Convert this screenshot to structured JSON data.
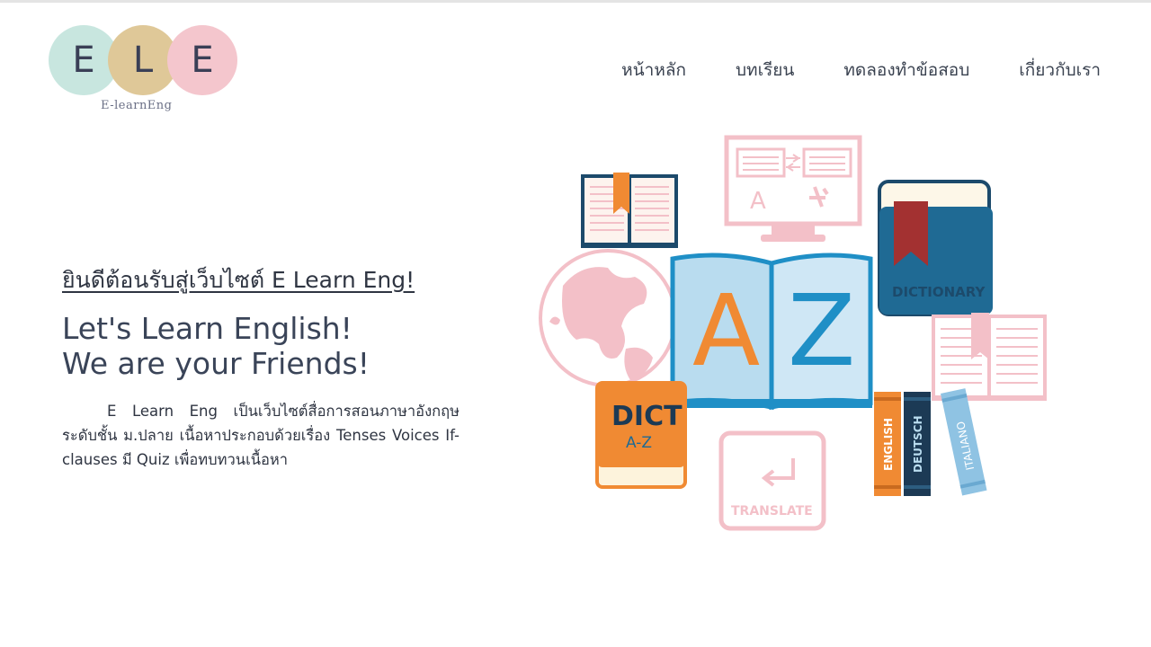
{
  "logo": {
    "letters": [
      "E",
      "L",
      "E"
    ],
    "tagline": "E-learnEng",
    "colors": [
      "#c8e6df",
      "#dfc898",
      "#f4c6cd"
    ]
  },
  "nav": {
    "items": [
      {
        "label": "หน้าหลัก"
      },
      {
        "label": "บทเรียน"
      },
      {
        "label": "ทดลองทำข้อสอบ"
      },
      {
        "label": "เกี่ยวกับเรา"
      }
    ]
  },
  "hero": {
    "welcome": "ยินดีต้อนรับสู่เว็บไซต์ E Learn Eng!",
    "headline1": "Let's Learn English!",
    "headline2": "We are your Friends!",
    "description": "E Learn Eng เป็นเว็บไซต์สื่อการสอนภาษาอังกฤษระดับชั้น ม.ปลาย เนื้อหาประกอบด้วยเรื่อง Tenses Voices If-clauses มี Quiz เพื่อทบทวนเนื้อหา"
  },
  "illustration": {
    "book_letter_left": "A",
    "book_letter_right": "Z",
    "dictionary_label": "DICTIONARY",
    "dict_title": "DICT",
    "dict_subtitle": "A-Z",
    "translate_label": "TRANSLATE",
    "monitor_letter": "A",
    "spine_labels": [
      "ENGLISH",
      "DEUTSCH",
      "ITALIANO"
    ],
    "colors": {
      "orange": "#f08a33",
      "blue": "#1f8fc6",
      "lightblue": "#b9dcef",
      "navy": "#1c4a6b",
      "pink": "#f3c0c8",
      "darkred": "#a33131"
    }
  }
}
